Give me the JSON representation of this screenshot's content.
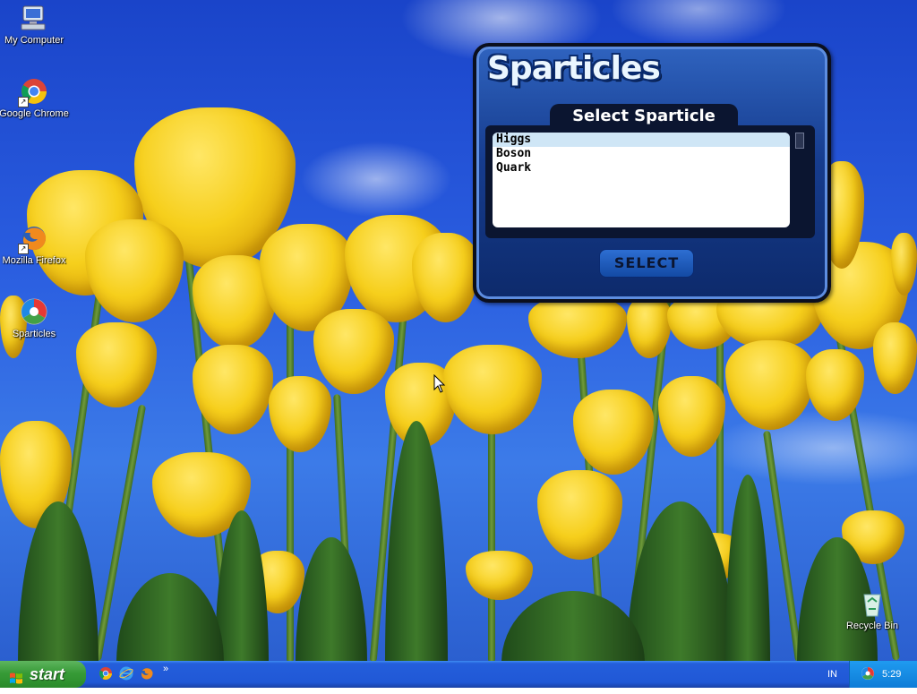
{
  "desktop": {
    "icons": [
      {
        "label": "My Computer",
        "icon": "my-computer-icon"
      },
      {
        "label": "Google Chrome",
        "icon": "chrome-icon"
      },
      {
        "label": "Mozilla Firefox",
        "icon": "firefox-icon"
      },
      {
        "label": "Sparticles",
        "icon": "sparticles-icon"
      },
      {
        "label": "Recycle Bin",
        "icon": "recycle-bin-icon"
      }
    ]
  },
  "sparticles": {
    "logo_text": "Sparticles",
    "header": "Select Sparticle",
    "list": [
      "Higgs",
      "Boson",
      "Quark"
    ],
    "selected_index": 0,
    "select_button": "SELECT",
    "colors": {
      "frame": "#163c8e",
      "panel": "#0b1530",
      "selected_row": "#cfe6f6"
    }
  },
  "taskbar": {
    "start_label": "start",
    "quick_launch": [
      "chrome-icon",
      "internet-explorer-icon",
      "firefox-icon"
    ],
    "overflow": "»",
    "language": "IN",
    "clock": "5:29"
  }
}
